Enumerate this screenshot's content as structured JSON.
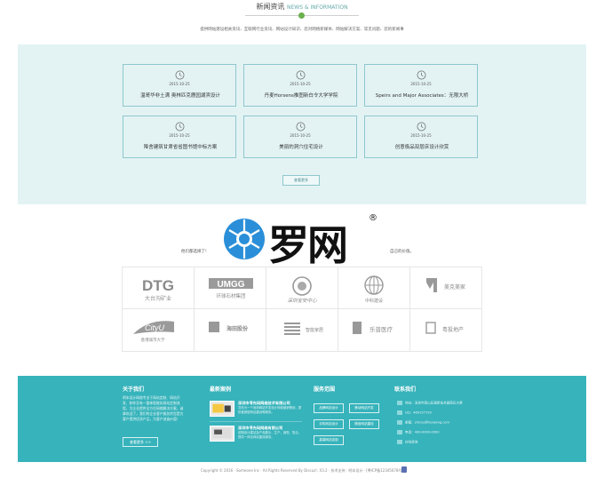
{
  "news": {
    "title": "新闻资讯",
    "title_en": "NEWS & INFORMATION",
    "subtitle": "提供网站建设相关资讯、互联网行业资讯、网站设计知识、您对网络新媒体、网站解决方案、常见问题、您的新闻事",
    "more_label": "查看更多",
    "items": [
      {
        "date": "2015-10-25",
        "title": "温哥华非土满 奥林匹克鹿园湖滨设计"
      },
      {
        "date": "2015-10-25",
        "title": "丹麦Horsens推图新白令大学学院"
      },
      {
        "date": "2015-10-25",
        "title": "Speirs and Major Associates：无限大桥"
      },
      {
        "date": "2015-10-25",
        "title": "降舍建筑甘肃省省图书馆中标方案"
      },
      {
        "date": "2015-10-25",
        "title": "美丽的洞穴住宅设计"
      },
      {
        "date": "2015-10-25",
        "title": "创意极品双层床设计欣赏"
      }
    ]
  },
  "watermark": {
    "text": "罗网",
    "reg": "®"
  },
  "partners": {
    "intro_left": "他们都选择了!",
    "intro_right": "自己的价值。",
    "logos": [
      {
        "name": "DTG",
        "sub": "大台沟矿业"
      },
      {
        "name": "UMGG",
        "sub": "环球石材集团"
      },
      {
        "name": "",
        "sub": "深圳宝安中心"
      },
      {
        "name": "",
        "sub": "中科建设"
      },
      {
        "name": "",
        "sub": "美克美家"
      },
      {
        "name": "CityU",
        "sub": "香港城市大学"
      },
      {
        "name": "",
        "sub": "海田股份"
      },
      {
        "name": "",
        "sub": "智能家居"
      },
      {
        "name": "",
        "sub": "乐普医疗"
      },
      {
        "name": "",
        "sub": "粤投地产"
      }
    ]
  },
  "footer": {
    "about": {
      "heading": "关于我们",
      "text": "明本设计网络专业于网站定制、网站开发、制作及有一整体智能化网站定制流程，为企业提供全方位网络解决方案，诚挚欢迎了，我们的企业客户服务宗旨是为客户提供优质产品，为客户创造价值！",
      "more_label": "查看更多 >>"
    },
    "cases": {
      "heading": "最新案例",
      "items": [
        {
          "title": "深圳市寻先码网络技术有限公司",
          "desc": "寻先为一个深圳网站开发设计网络营销策划，提供营销型网站建设等服务。"
        },
        {
          "title": "深圳市寻先码网络有限公司",
          "desc": "前期设计建站及产品展示，生产、销售、售后，提供一体化网站建设服务。"
        }
      ]
    },
    "services": {
      "heading": "服务范围",
      "items": [
        "品牌网站设计",
        "移动网站开发",
        "手机网站设计",
        "微信网站建设",
        "高端网站定制"
      ]
    },
    "contact": {
      "heading": "联系我们",
      "items": [
        {
          "label": "地址：深圳市南山区高新技术园南区大厦"
        },
        {
          "label": "QQ：469157729"
        },
        {
          "label": "邮箱：zhicuo@luowang.com"
        },
        {
          "label": "电话：400-0000-0000"
        },
        {
          "label": "在线咨询"
        }
      ]
    }
  },
  "copyright": "Copyright © 2016 · Someone Inc · All Rights Reserved By Discuz!, X3.2 · 技术支持：明本设计 · [粤ICP备12345678号]"
}
